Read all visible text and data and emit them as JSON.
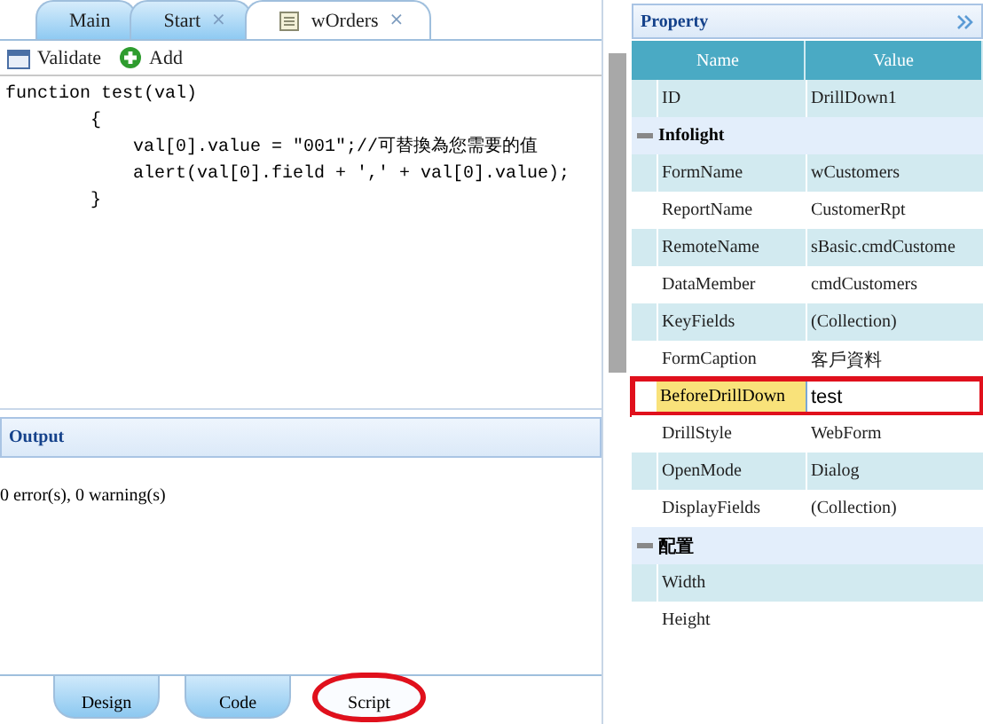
{
  "doc_tabs": [
    {
      "label": "Main",
      "selected": false,
      "icon": false
    },
    {
      "label": "Start",
      "selected": false,
      "close": "×",
      "icon": false
    },
    {
      "label": "wOrders",
      "selected": true,
      "close": "×",
      "icon": true
    }
  ],
  "toolbar": [
    {
      "label": "Validate",
      "kind": "validate"
    },
    {
      "label": "Add",
      "kind": "add"
    }
  ],
  "code_lines": [
    "function test(val)",
    "        {",
    "            val[0].value = \"001\";//可替換為您需要的值",
    "            alert(val[0].field + ',' + val[0].value);",
    "        }"
  ],
  "output": {
    "title": "Output",
    "message": "0 error(s), 0 warning(s)"
  },
  "view_tabs": [
    {
      "label": "Design",
      "selected": false,
      "circled": false
    },
    {
      "label": "Code",
      "selected": false,
      "circled": false
    },
    {
      "label": "Script",
      "selected": true,
      "circled": true
    }
  ],
  "property_panel": {
    "title": "Property",
    "columns": [
      "Name",
      "Value"
    ],
    "rows": [
      {
        "kind": "property",
        "name": "ID",
        "value": "DrillDown1"
      },
      {
        "kind": "group",
        "name": "Infolight"
      },
      {
        "kind": "property",
        "name": "FormName",
        "value": "wCustomers"
      },
      {
        "kind": "property",
        "name": "ReportName",
        "value": "CustomerRpt"
      },
      {
        "kind": "property",
        "name": "RemoteName",
        "value": "sBasic.cmdCustome"
      },
      {
        "kind": "property",
        "name": "DataMember",
        "value": "cmdCustomers"
      },
      {
        "kind": "property",
        "name": "KeyFields",
        "value": "(Collection)"
      },
      {
        "kind": "property",
        "name": "FormCaption",
        "value": "客戶資料"
      },
      {
        "kind": "editing",
        "name": "BeforeDrillDown",
        "value": "test",
        "highlighted": true
      },
      {
        "kind": "property",
        "name": "DrillStyle",
        "value": "WebForm"
      },
      {
        "kind": "property",
        "name": "OpenMode",
        "value": "Dialog"
      },
      {
        "kind": "property",
        "name": "DisplayFields",
        "value": "(Collection)"
      },
      {
        "kind": "group",
        "name": "配置"
      },
      {
        "kind": "property",
        "name": "Width"
      },
      {
        "kind": "property",
        "name": "Height"
      }
    ]
  }
}
